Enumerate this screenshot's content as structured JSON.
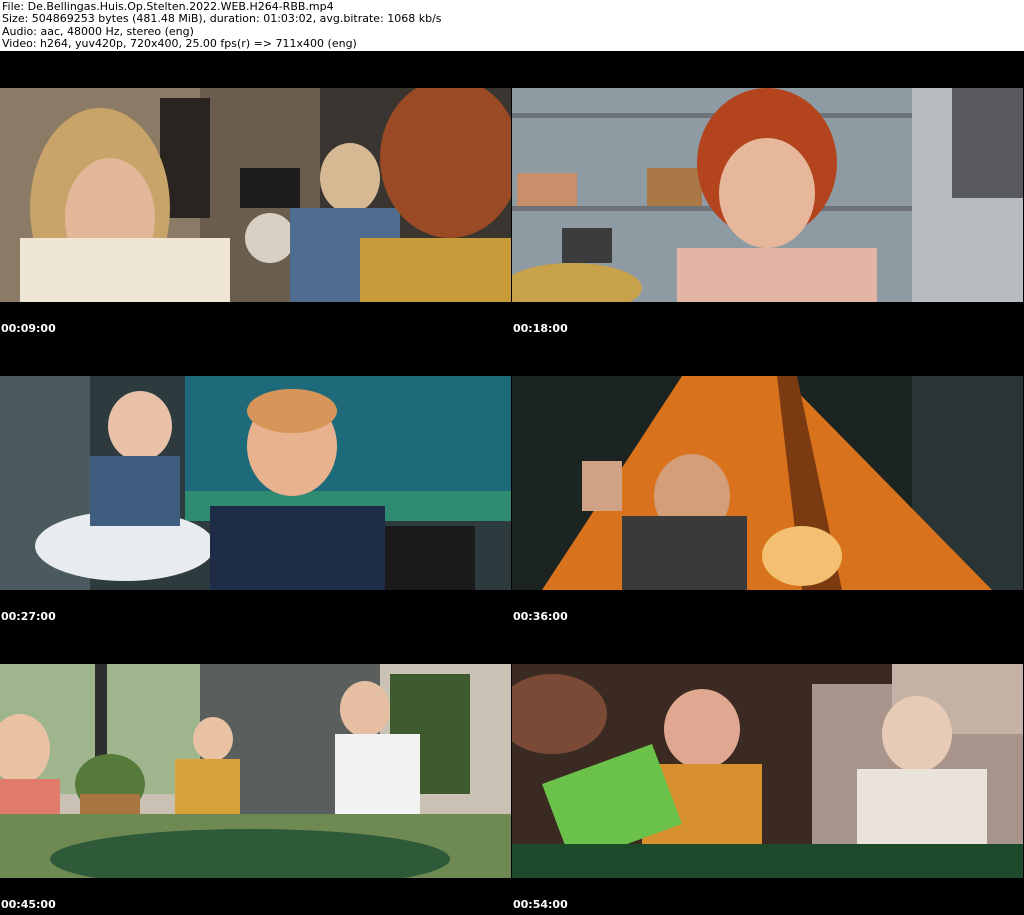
{
  "header": {
    "file_line": "File: De.Bellingas.Huis.Op.Stelten.2022.WEB.H264-RBB.mp4",
    "size_line": "Size: 504869253 bytes (481.48 MiB), duration: 01:03:02, avg.bitrate: 1068 kb/s",
    "audio_line": "Audio: aac, 48000 Hz, stereo (eng)",
    "video_line": "Video: h264, yuv420p, 720x400, 25.00 fps(r) => 711x400 (eng)"
  },
  "thumbnails": [
    {
      "timestamp": "00:09:00",
      "scene": "kitchen-conversation"
    },
    {
      "timestamp": "00:18:00",
      "scene": "redhead-woman-shelves"
    },
    {
      "timestamp": "00:27:00",
      "scene": "baby-and-boy-aquarium"
    },
    {
      "timestamp": "00:36:00",
      "scene": "child-in-orange-tent"
    },
    {
      "timestamp": "00:45:00",
      "scene": "children-at-table"
    },
    {
      "timestamp": "00:54:00",
      "scene": "kids-under-green-net"
    }
  ],
  "colors": {
    "background": "#000000",
    "header_bg": "#ffffff",
    "timestamp_text": "#ffffff"
  }
}
